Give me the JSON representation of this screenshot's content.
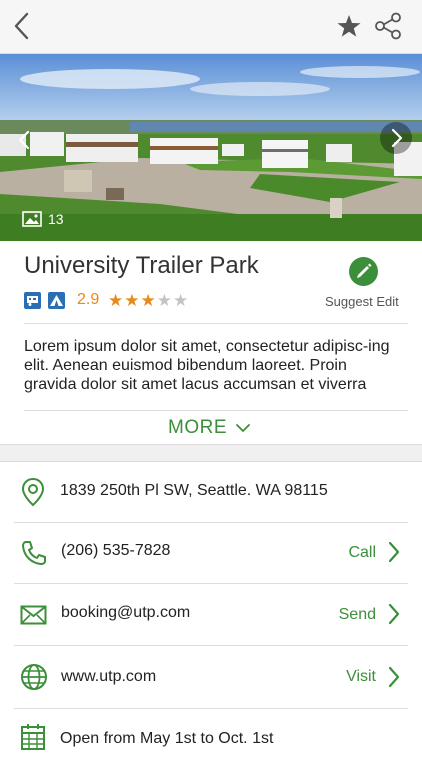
{
  "header": {
    "back_icon": "chevron-left-icon",
    "favorite_icon": "star-icon",
    "share_icon": "share-icon"
  },
  "gallery": {
    "photo_count": "13"
  },
  "listing": {
    "name": "University Trailer Park",
    "rating": "2.9",
    "stars_filled": 3,
    "stars_total": 5,
    "edit_label": "Suggest Edit",
    "description": "Lorem ipsum dolor sit amet, consectetur adipisc-ing elit. Aenean euismod bibendum laoreet. Proin gravida dolor sit amet lacus accumsan et viverra",
    "more_label": "MORE"
  },
  "details": {
    "address": "1839 250th Pl SW, Seattle. WA 98115",
    "phone": "(206) 535-7828",
    "phone_action": "Call",
    "email": "booking@utp.com",
    "email_action": "Send",
    "website": "www.utp.com",
    "website_action": "Visit",
    "hours": "Open from May 1st to Oct. 1st"
  },
  "colors": {
    "accent": "#3c8f3a",
    "rating": "#e88a1b",
    "badge": "#2a6fb4"
  }
}
